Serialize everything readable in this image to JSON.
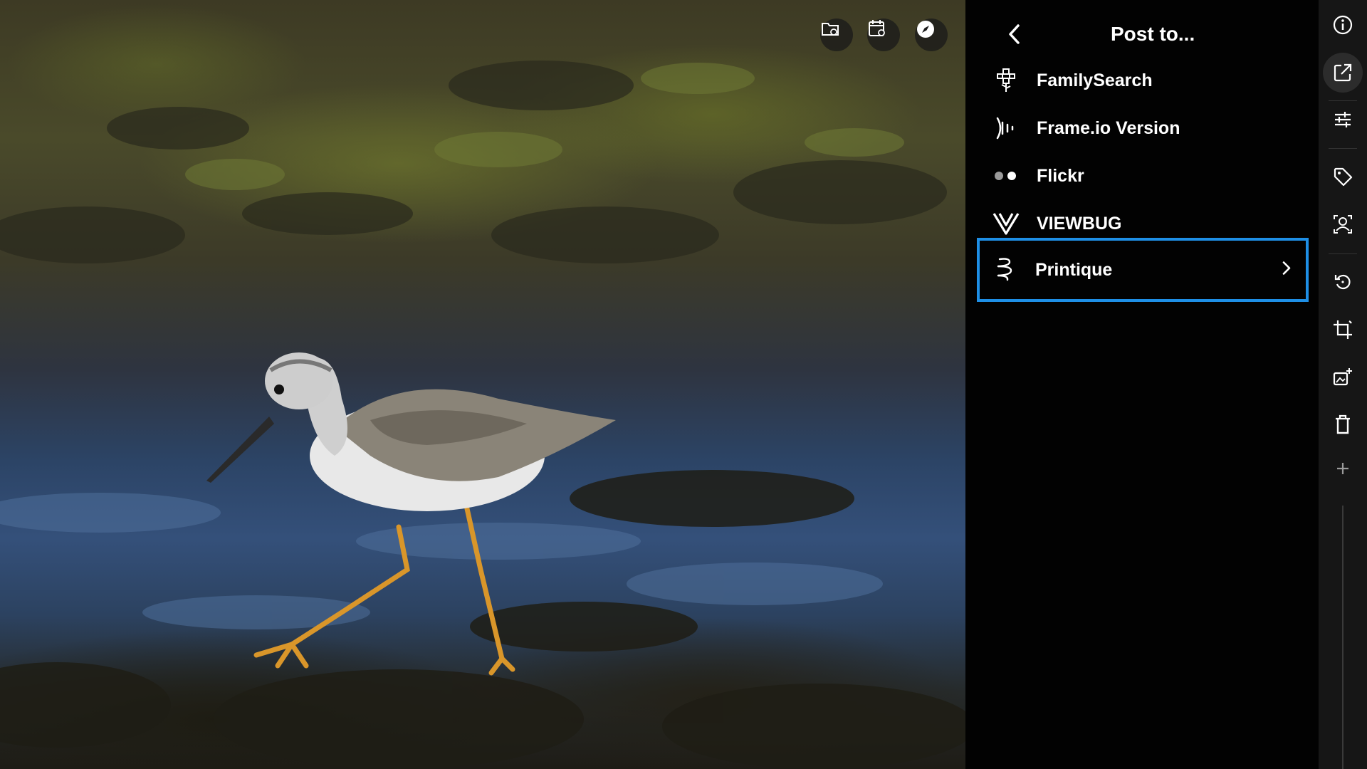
{
  "viewer": {
    "photo_subject": "",
    "top_tools": [
      {
        "name": "folder-settings-icon"
      },
      {
        "name": "calendar-settings-icon"
      },
      {
        "name": "compass-icon"
      }
    ]
  },
  "panel": {
    "title": "Post to...",
    "back_icon": "chevron-left-icon",
    "services": [
      {
        "label": "FamilySearch",
        "icon": "familysearch-tree-icon"
      },
      {
        "label": "Frame.io Version",
        "icon": "frameio-icon"
      },
      {
        "label": "Flickr",
        "icon": "flickr-dots-icon"
      },
      {
        "label": "VIEWBUG",
        "icon": "viewbug-icon"
      },
      {
        "label": "Printique",
        "icon": "printique-icon",
        "selected": true
      }
    ],
    "selected_outline_color": "#1e8fe6"
  },
  "toolbar": {
    "items": [
      {
        "name": "info-icon"
      },
      {
        "name": "share-external-icon",
        "active": true
      },
      {
        "name": "sliders-icon"
      },
      {
        "name": "tag-icon"
      },
      {
        "name": "person-recognize-icon"
      },
      {
        "name": "rotate-icon"
      },
      {
        "name": "crop-icon"
      },
      {
        "name": "image-enhance-icon"
      },
      {
        "name": "trash-icon"
      },
      {
        "name": "plus-icon"
      }
    ]
  }
}
